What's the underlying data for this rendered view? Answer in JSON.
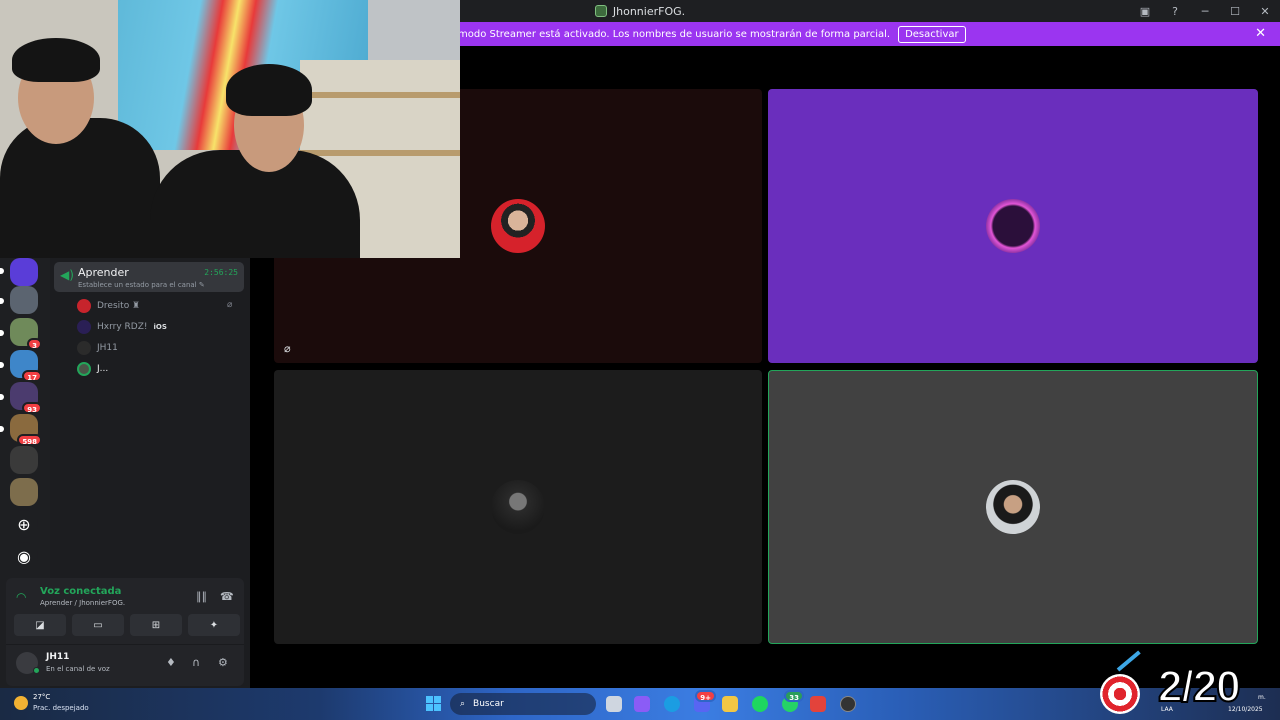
{
  "window": {
    "title": "JhonnierFOG."
  },
  "banner": {
    "message": "modo Streamer está activado. Los nombres de usuario se mostrarán de forma parcial.",
    "button_label": "Desactivar"
  },
  "rail": {
    "badges": [
      "3",
      "17",
      "93",
      "598"
    ]
  },
  "channel": {
    "name": "Aprender",
    "timer": "2:56:25",
    "status_placeholder": "Establece un estado para el canal ✎",
    "members": [
      {
        "name": "Dresito ♜",
        "muted": true
      },
      {
        "name": "Hxrry RDZ!",
        "tag": "iOS"
      },
      {
        "name": "JH11"
      },
      {
        "name": "J..."
      }
    ]
  },
  "voice": {
    "title": "Voz conectada",
    "location": "Aprender / JhonnierFOG."
  },
  "user": {
    "name": "JH11",
    "status": "En el canal de voz"
  },
  "taskbar": {
    "weather_temp": "27°C",
    "weather_desc": "Prac. despejado",
    "search_label": "Buscar",
    "notification_count_1": "9+",
    "notification_count_2": "33",
    "language": "LAA",
    "date": "12/10/2025",
    "time_suffix": "m."
  },
  "goal": {
    "count": "2/20"
  },
  "colors": {
    "accent_purple": "#9b35f0",
    "voice_green": "#23a55a",
    "tile_purple": "#6a2ebd",
    "tile_dark_red": "#1b0b0b"
  }
}
